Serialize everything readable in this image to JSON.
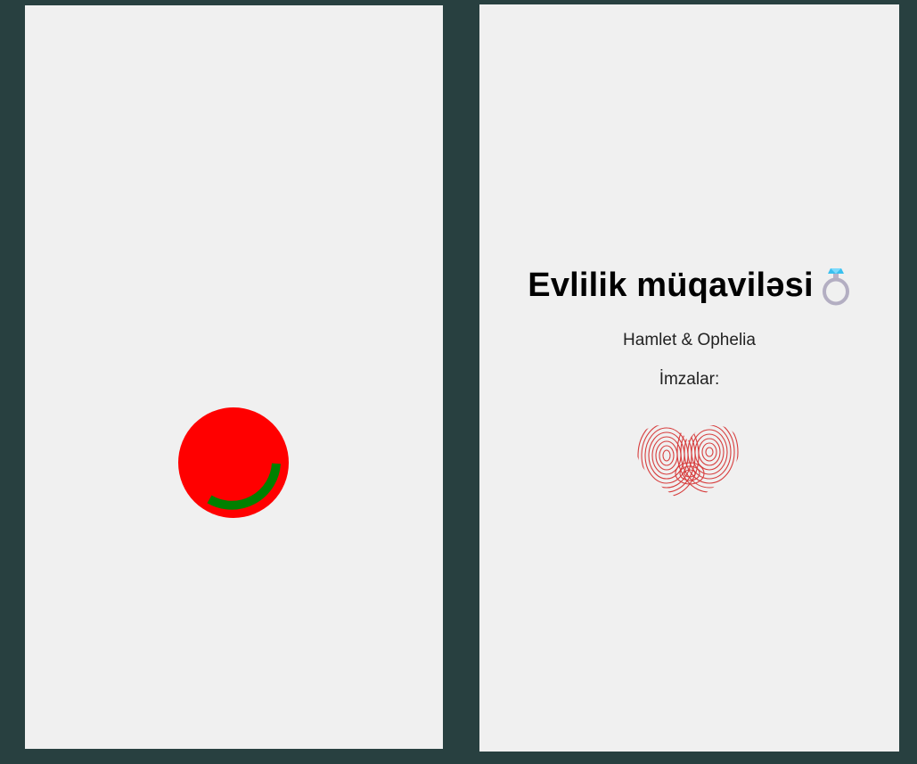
{
  "left_panel": {
    "loader": {
      "icon": "loading-spinner-icon",
      "circle_color": "#ff0000",
      "arc_color": "#008000"
    }
  },
  "right_panel": {
    "title": "Evlilik müqaviləsi",
    "title_icon": "ring-icon",
    "couple": "Hamlet & Ophelia",
    "signatures_label": "İmzalar:",
    "signature_icon": "fingerprint-heart-icon",
    "signature_color": "#d42a2a"
  },
  "colors": {
    "background": "#284040",
    "panel": "#f0f0f0"
  }
}
